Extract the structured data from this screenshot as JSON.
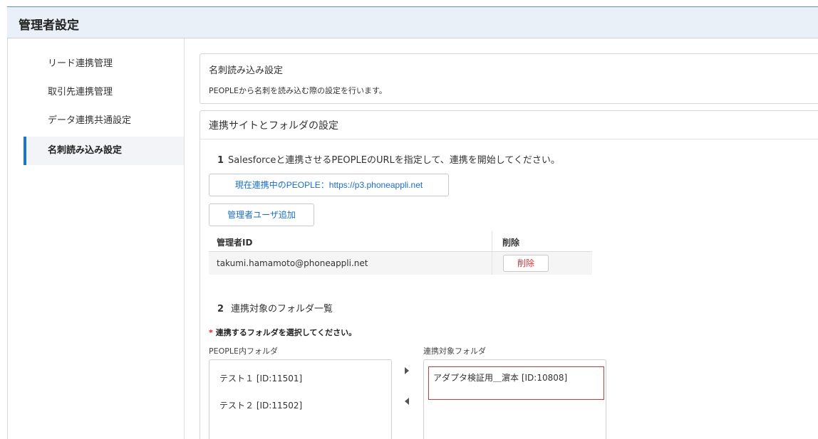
{
  "header": {
    "title": "管理者設定"
  },
  "sidebar": {
    "items": [
      {
        "label": "リード連携管理"
      },
      {
        "label": "取引先連携管理"
      },
      {
        "label": "データ連携共通設定"
      },
      {
        "label": "名刺読み込み設定"
      }
    ]
  },
  "section1": {
    "title": "名刺読み込み設定",
    "description": "PEOPLEから名刺を読み込む際の設定を行います。"
  },
  "section2": {
    "title": "連携サイトとフォルダの設定",
    "step1": {
      "number": "1",
      "text": "Salesforceと連携させるPEOPLEのURLを指定して、連携を開始してください。"
    },
    "current_people_button": "現在連携中のPEOPLE：https://p3.phoneappli.net",
    "add_admin_button": "管理者ユーザ追加",
    "admin_table": {
      "columns": [
        "管理者ID",
        "削除"
      ],
      "rows": [
        {
          "admin_id": "takumi.hamamoto@phoneappli.net",
          "delete_label": "削除"
        }
      ]
    },
    "step2": {
      "number": "2",
      "text": "連携対象のフォルダ一覧"
    },
    "required_star": "*",
    "required_note": "連携するフォルダを選択してください。",
    "people_folder_label": "PEOPLE内フォルダ",
    "people_folders": [
      "テスト１ [ID:11501]",
      "テスト２ [ID:11502]"
    ],
    "target_folder_label": "連携対象フォルダ",
    "target_folders": [
      "アダプタ検証用＿濵本 [ID:10808]"
    ]
  }
}
